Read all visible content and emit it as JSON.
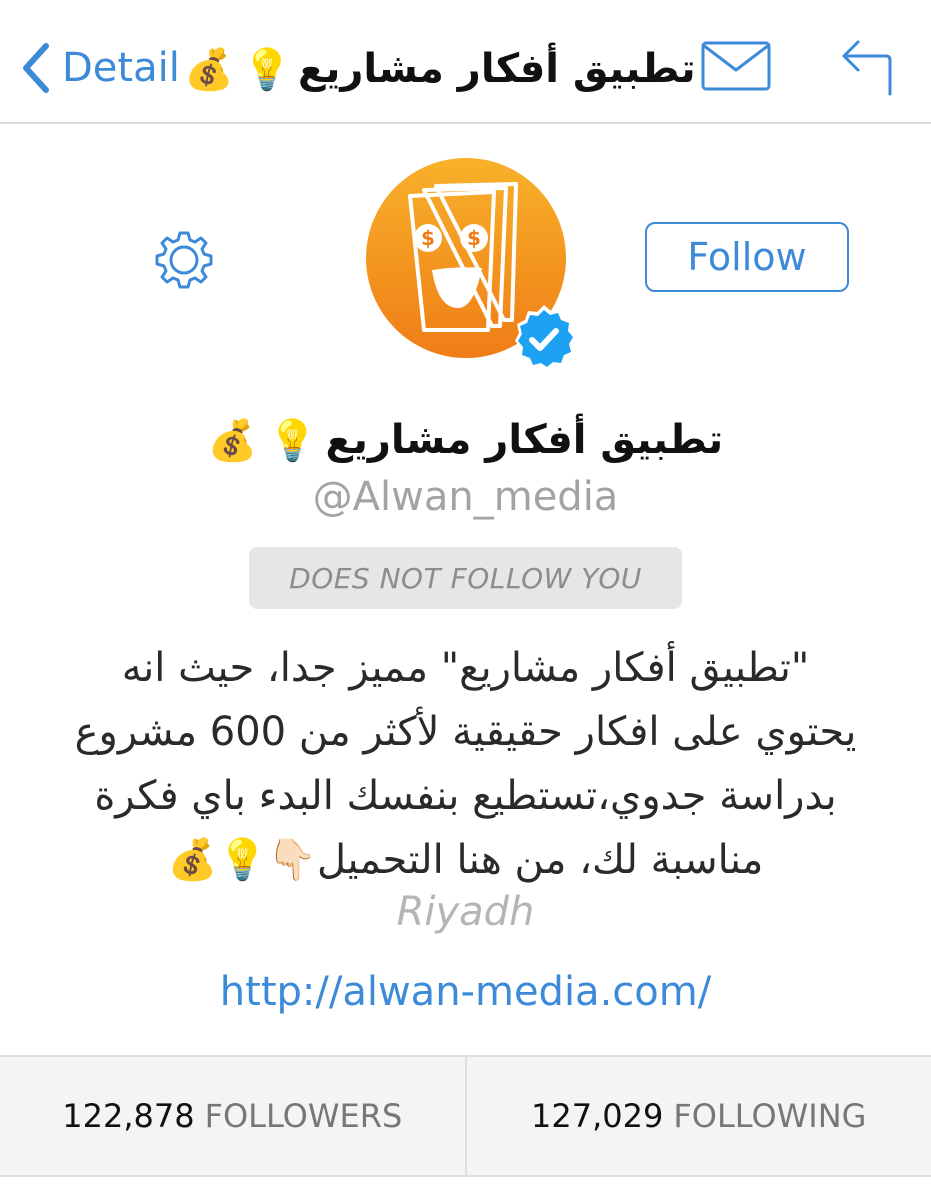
{
  "nav": {
    "back_label": "Detail",
    "title": "تطبيق أفكار مشاريع",
    "title_emojis": [
      "💡",
      "💰"
    ]
  },
  "profile": {
    "name": "تطبيق أفكار مشاريع",
    "name_emojis": [
      "💡",
      "💰"
    ],
    "handle": "@Alwan_media",
    "follow_button_label": "Follow",
    "follow_status": "DOES NOT FOLLOW YOU",
    "verified": true,
    "avatar_icon": "money-smile-logo",
    "bio_lines": [
      "\"تطبيق أفكار مشاريع\" مميز جدا، حيث انه",
      "يحتوي على افكار حقيقية لأكثر من 600 مشروع",
      "بدراسة جدوي،تستطيع بنفسك البدء باي فكرة",
      "مناسبة لك، من هنا التحميل👇🏻💡💰"
    ],
    "location": "Riyadh",
    "website": "http://alwan-media.com/"
  },
  "stats": {
    "followers_count": "122,878",
    "followers_label": "FOLLOWERS",
    "following_count": "127,029",
    "following_label": "FOLLOWING"
  },
  "colors": {
    "accent": "#3d8ad8",
    "avatar_orange": "#f49c1a",
    "verified_blue": "#1da1f2"
  },
  "icons": [
    "back-chevron-icon",
    "mail-icon",
    "reply-icon",
    "gear-icon",
    "verified-badge-icon"
  ]
}
